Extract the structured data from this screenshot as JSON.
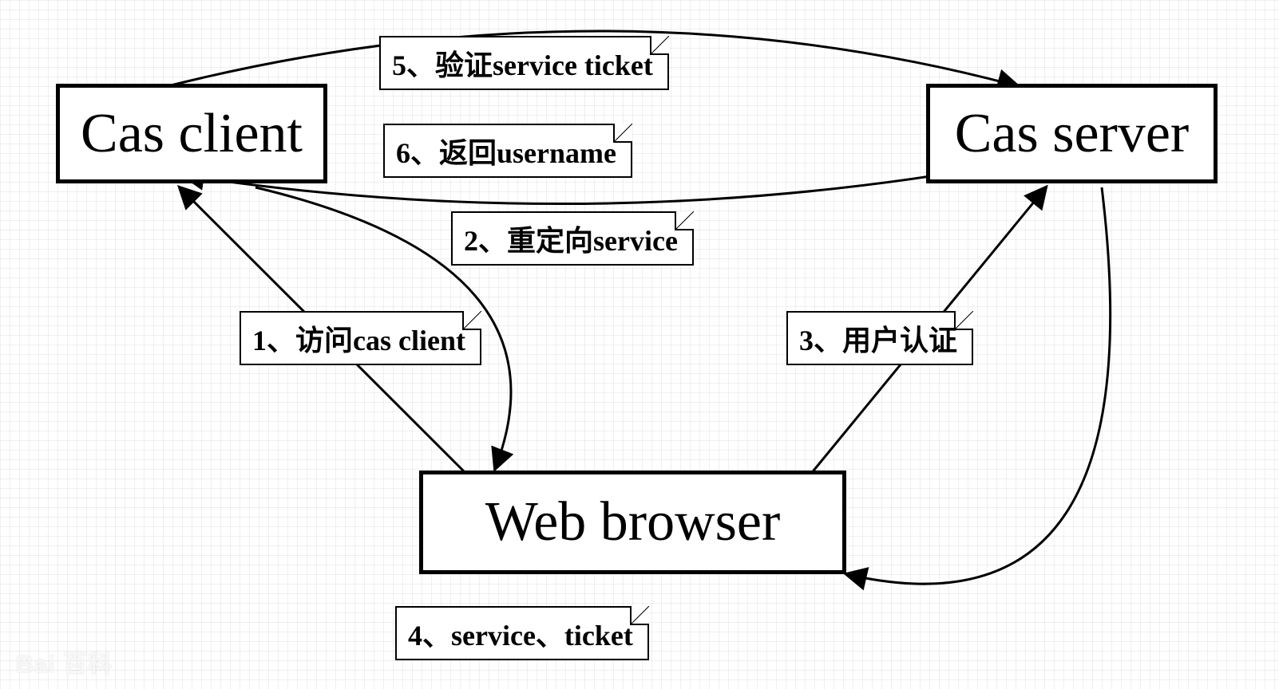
{
  "nodes": {
    "client": "Cas client",
    "server": "Cas server",
    "browser": "Web browser"
  },
  "notes": {
    "n1": "1、访问cas client",
    "n2": "2、重定向service",
    "n3": "3、用户认证",
    "n4": "4、service、ticket",
    "n5": "5、验证service ticket",
    "n6": "6、返回username"
  },
  "watermark": "Bai 百科"
}
